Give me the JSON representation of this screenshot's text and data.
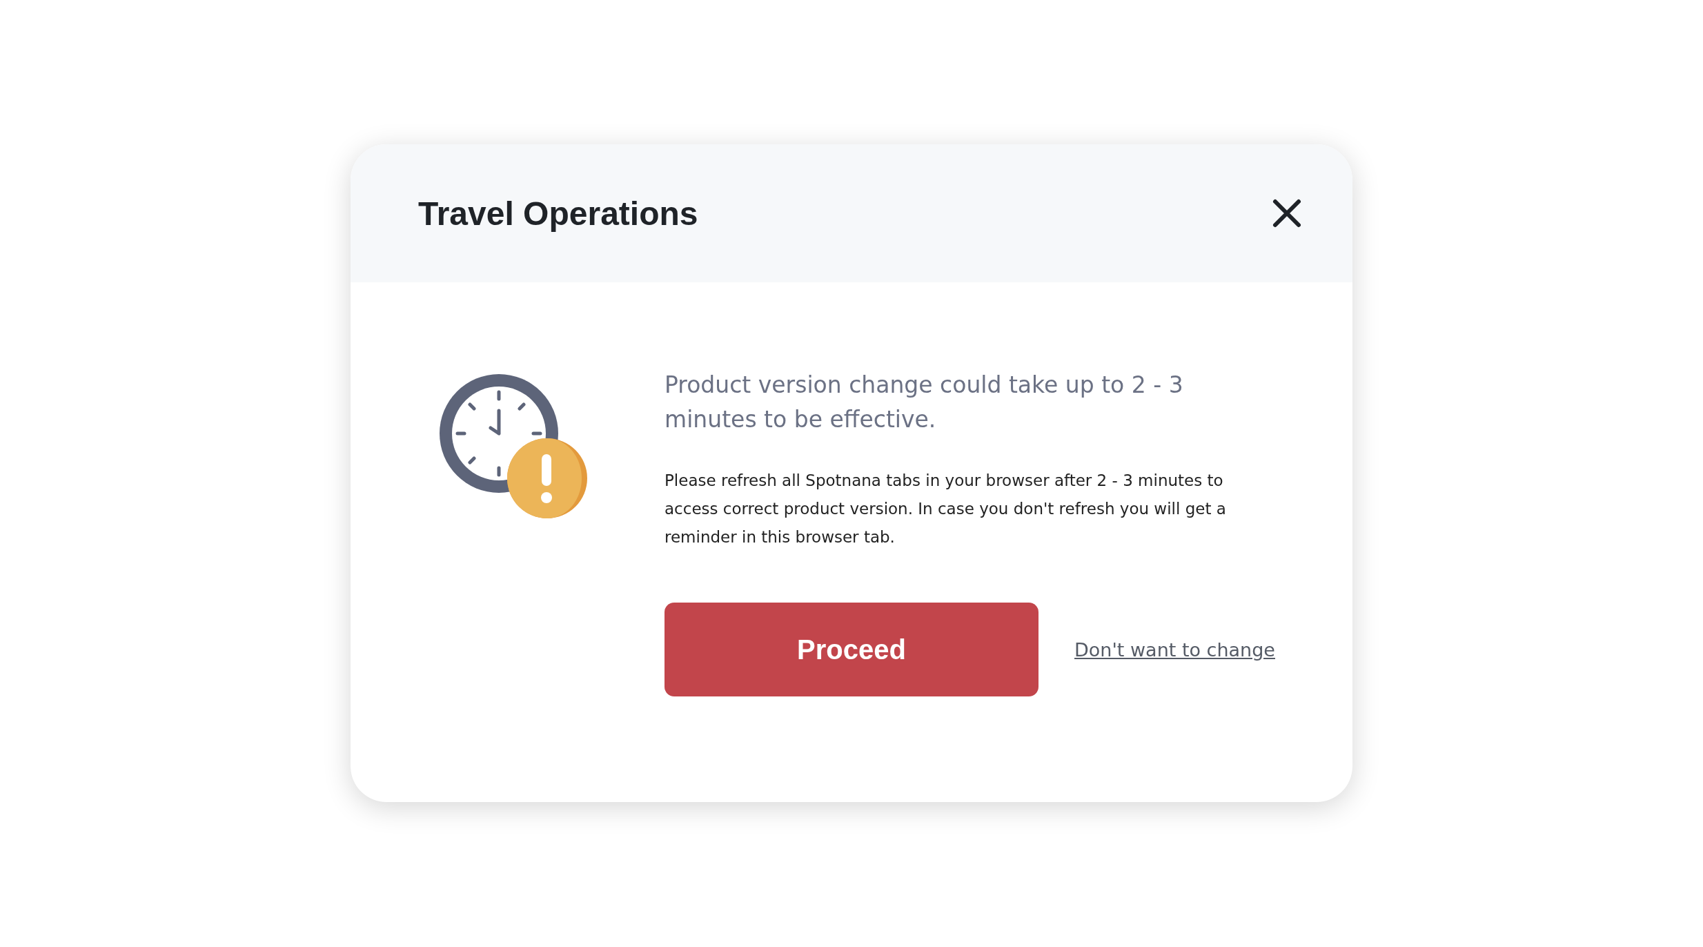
{
  "dialog": {
    "title": "Travel Operations",
    "heading": "Product version change could take up to 2 - 3 minutes to be effective.",
    "message": "Please refresh all Spotnana tabs in your browser after 2 - 3 minutes to access correct product version. In case you don't refresh you will get a reminder in this browser tab.",
    "primary_button": "Proceed",
    "link": "Don't want to change"
  }
}
